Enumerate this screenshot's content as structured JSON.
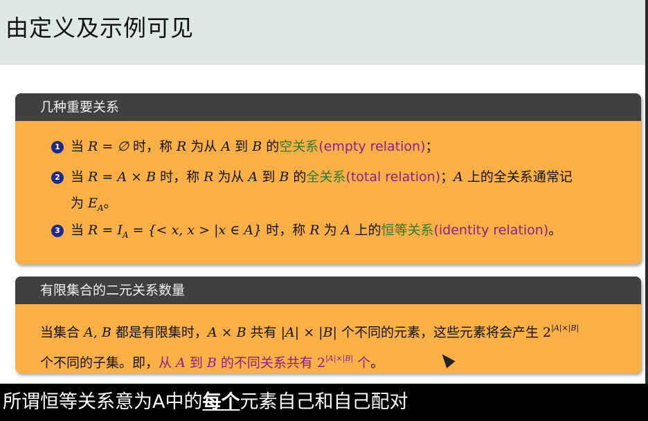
{
  "slide": {
    "title": "由定义及示例可见",
    "block1": {
      "heading": "几种重要关系",
      "items": [
        {
          "num": "1",
          "pre": "当 ",
          "math": "R = ∅",
          "mid": " 时，称 ",
          "r": "R",
          "mid2": " 为从 ",
          "a": "A",
          "mid3": " 到 ",
          "b": "B",
          "mid4": " 的",
          "term": "空关系",
          "en": "(empty relation)",
          "post": "；"
        },
        {
          "num": "2",
          "pre": "当 ",
          "math": "R = A × B",
          "mid": " 时，称 ",
          "r": "R",
          "mid2": " 为从 ",
          "a": "A",
          "mid3": " 到 ",
          "b": "B",
          "mid4": " 的",
          "term": "全关系",
          "en": "(total relation)",
          "post": "；",
          "post2": "A",
          "post3": " 上的全关系通常记",
          "line2": "为 ",
          "line2math": "E",
          "line2sub": "A",
          "line2post": "。"
        },
        {
          "num": "3",
          "pre": "当 ",
          "math": "R = I",
          "math_sub": "A",
          "math2": " = {< x, x > |x ∈ A}",
          "mid": " 时，称 ",
          "r": "R",
          "mid2": " 为 ",
          "a": "A",
          "mid3": " 上的",
          "term": "恒等关系",
          "en": "(identity relation)",
          "post": "。"
        }
      ]
    },
    "block2": {
      "heading": "有限集合的二元关系数量",
      "line1_a": "当集合 ",
      "line1_ab": "A, B",
      "line1_b": " 都是有限集时，",
      "line1_axb": "A × B",
      "line1_c": " 共有 ",
      "line1_card": "|A| × |B|",
      "line1_d": " 个不同的元素，这些元素将会产生 ",
      "two": "2",
      "exp": "|A|×|B|",
      "line2_a": "个不同的子集。即，",
      "line2_b": "从 ",
      "line2_A": "A",
      "line2_c": " 到 ",
      "line2_B": "B",
      "line2_d": " 的不同关系共有 ",
      "line2_two": "2",
      "line2_exp": "|A|×|B|",
      "line2_e": " 个",
      "line2_f": "。"
    }
  },
  "subtitle": {
    "pre": "所谓恒等关系意为A中的",
    "bold": "每个",
    "post": "元素自己和自己配对"
  }
}
